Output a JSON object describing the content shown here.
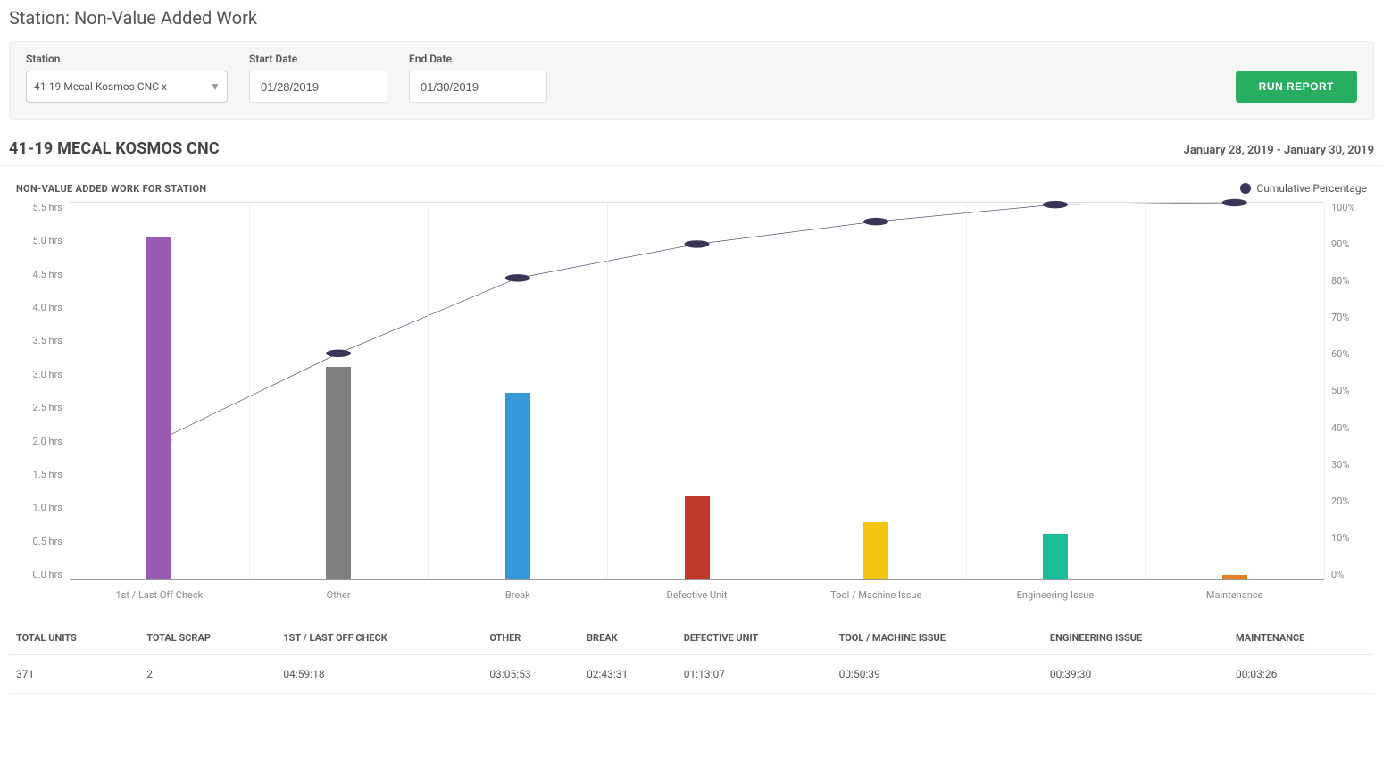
{
  "page_title": "Station: Non-Value Added Work",
  "filters": {
    "station_label": "Station",
    "station_value": "41-19 Mecal Kosmos CNC x",
    "start_date_label": "Start Date",
    "start_date_value": "01/28/2019",
    "end_date_label": "End Date",
    "end_date_value": "01/30/2019",
    "run_button": "RUN REPORT"
  },
  "section": {
    "title": "41-19 MECAL KOSMOS CNC",
    "date_range": "January 28, 2019 - January 30, 2019"
  },
  "chart_subtitle": "NON-VALUE ADDED WORK FOR STATION",
  "legend_label": "Cumulative Percentage",
  "chart_data": {
    "type": "bar",
    "title": "Non-Value Added Work for Station",
    "xlabel": "",
    "ylabel": "Hours",
    "ylim": [
      0,
      5.5
    ],
    "y2label": "Cumulative Percentage",
    "y2lim": [
      0,
      100
    ],
    "categories": [
      "1st / Last Off Check",
      "Other",
      "Break",
      "Defective Unit",
      "Tool / Machine Issue",
      "Engineering Issue",
      "Maintenance"
    ],
    "series": [
      {
        "name": "Hours",
        "type": "bar",
        "values": [
          4.99,
          3.1,
          2.73,
          1.22,
          0.84,
          0.66,
          0.06
        ],
        "colors": [
          "#9b59b6",
          "#808080",
          "#3498db",
          "#c0392b",
          "#f1c40f",
          "#1abc9c",
          "#e67e22"
        ]
      },
      {
        "name": "Cumulative Percentage",
        "type": "line",
        "axis": "y2",
        "values": [
          37,
          60,
          80,
          89,
          95,
          99.5,
          100
        ],
        "color": "#3a3557"
      }
    ],
    "y_ticks": [
      "5.5 hrs",
      "5.0 hrs",
      "4.5 hrs",
      "4.0 hrs",
      "3.5 hrs",
      "3.0 hrs",
      "2.5 hrs",
      "2.0 hrs",
      "1.5 hrs",
      "1.0 hrs",
      "0.5 hrs",
      "0.0 hrs"
    ],
    "y2_ticks": [
      "100%",
      "90%",
      "80%",
      "70%",
      "60%",
      "50%",
      "40%",
      "30%",
      "20%",
      "10%",
      "0%"
    ]
  },
  "table": {
    "headers": [
      "TOTAL UNITS",
      "TOTAL SCRAP",
      "1ST / LAST OFF CHECK",
      "OTHER",
      "BREAK",
      "DEFECTIVE UNIT",
      "TOOL / MACHINE ISSUE",
      "ENGINEERING ISSUE",
      "MAINTENANCE"
    ],
    "row": [
      "371",
      "2",
      "04:59:18",
      "03:05:53",
      "02:43:31",
      "01:13:07",
      "00:50:39",
      "00:39:30",
      "00:03:26"
    ]
  }
}
